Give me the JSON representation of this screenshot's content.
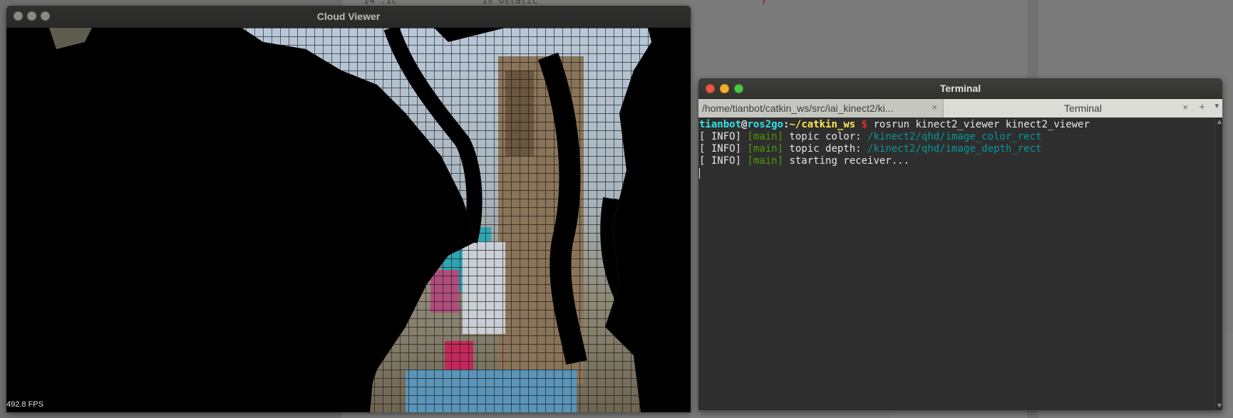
{
  "background": {
    "top_text_left": "14   .1c",
    "top_text_right": "1s Ostatic",
    "top_text_red": "y"
  },
  "cloud_viewer": {
    "title": "Cloud Viewer",
    "fps": "492.8 FPS"
  },
  "terminal": {
    "title": "Terminal",
    "tabs": [
      {
        "label": "/home/tianbot/catkin_ws/src/iai_kinect2/ki...",
        "close": "×"
      },
      {
        "label": "Terminal",
        "close": "×"
      }
    ],
    "new_tab_icon": "+",
    "menu_icon": "▾",
    "prompt": {
      "user": "tianbot",
      "at": "@",
      "host": "ros2go",
      "colon": ":",
      "path": "~/catkin_ws",
      "dollar": " $ ",
      "command": "rosrun kinect2_viewer kinect2_viewer"
    },
    "lines": [
      {
        "prefix": "[ INFO] ",
        "tag": "[main]",
        "text": " topic color: ",
        "topic": "/kinect2/qhd/image_color_rect"
      },
      {
        "prefix": "[ INFO] ",
        "tag": "[main]",
        "text": " topic depth: ",
        "topic": "/kinect2/qhd/image_depth_rect"
      },
      {
        "prefix": "[ INFO] ",
        "tag": "[main]",
        "text": " starting receiver...",
        "topic": ""
      }
    ]
  },
  "colors": {
    "close": "#e95744",
    "minimize": "#f5b02b",
    "maximize": "#4ac743",
    "prompt_user": "#34e2e2",
    "prompt_path": "#fce94f",
    "prompt_dollar": "#ef2929",
    "log_tag": "#4e9a06",
    "topic": "#06989a"
  }
}
